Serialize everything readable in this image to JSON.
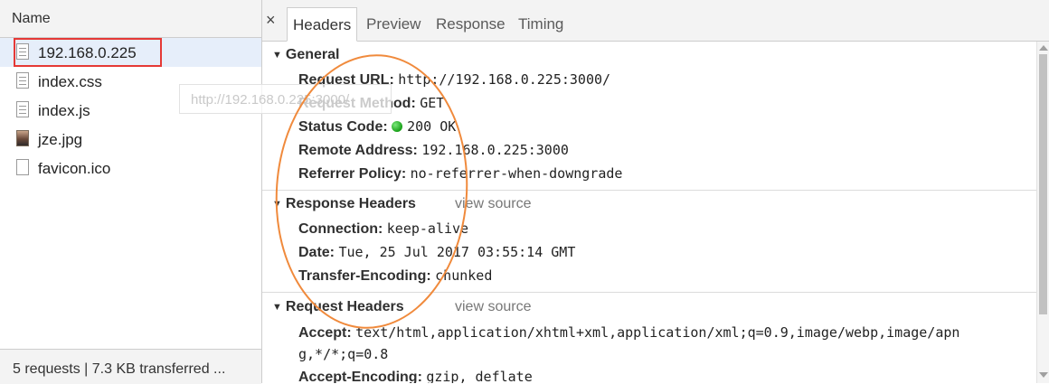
{
  "network": {
    "column_header": "Name",
    "files": [
      {
        "name": "192.168.0.225",
        "icon": "document-icon",
        "selected": true
      },
      {
        "name": "index.css",
        "icon": "document-icon"
      },
      {
        "name": "index.js",
        "icon": "document-icon"
      },
      {
        "name": "jze.jpg",
        "icon": "image-icon"
      },
      {
        "name": "favicon.ico",
        "icon": "blank-file-icon"
      }
    ],
    "tooltip": "http://192.168.0.225:3000/",
    "status_footer": "5 requests | 7.3 KB transferred ..."
  },
  "detail": {
    "close_glyph": "×",
    "tabs": [
      "Headers",
      "Preview",
      "Response",
      "Timing"
    ],
    "active_tab": "Headers",
    "general": {
      "title": "General",
      "rows": [
        {
          "key": "Request URL:",
          "value": "http://192.168.0.225:3000/"
        },
        {
          "key": "Request Method:",
          "value": "GET"
        },
        {
          "key": "Status Code:",
          "value": "200 OK"
        },
        {
          "key": "Remote Address:",
          "value": "192.168.0.225:3000"
        },
        {
          "key": "Referrer Policy:",
          "value": "no-referrer-when-downgrade"
        }
      ]
    },
    "response_headers": {
      "title": "Response Headers",
      "view_source": "view source",
      "rows": [
        {
          "key": "Connection:",
          "value": "keep-alive"
        },
        {
          "key": "Date:",
          "value": "Tue, 25 Jul 2017 03:55:14 GMT"
        },
        {
          "key": "Transfer-Encoding:",
          "value": "chunked"
        }
      ]
    },
    "request_headers": {
      "title": "Request Headers",
      "view_source": "view source",
      "rows": [
        {
          "key": "Accept:",
          "value": "text/html,application/xhtml+xml,application/xml;q=0.9,image/webp,image/apn"
        },
        {
          "key": "",
          "value": "g,*/*;q=0.8"
        },
        {
          "key": "Accept-Encoding:",
          "value": "gzip, deflate"
        }
      ]
    }
  },
  "colors": {
    "annotation_ellipse": "#f08a3c",
    "annotation_box": "#e53935",
    "status_ok": "#18a018",
    "selected_row": "#e6eefa"
  }
}
